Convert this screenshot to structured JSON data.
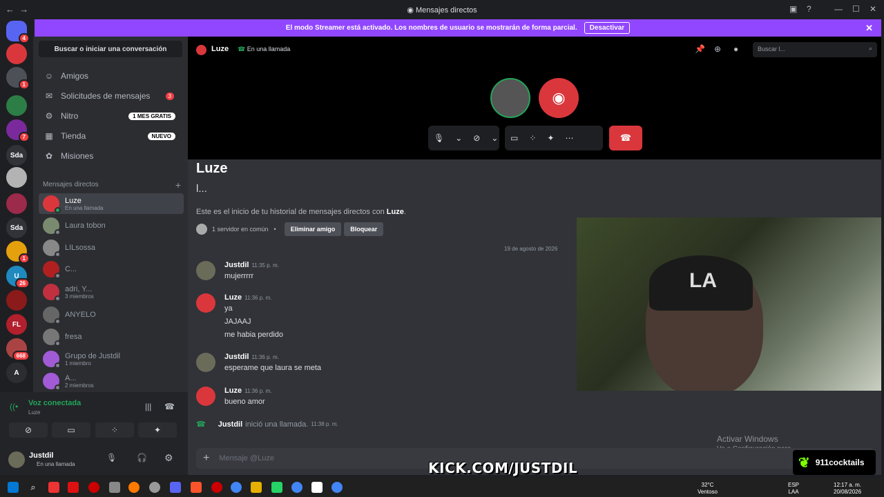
{
  "window": {
    "title": "Mensajes directos",
    "nav_back": "←",
    "nav_fwd": "→"
  },
  "banner": {
    "text": "El modo Streamer está activado. Los nombres de usuario se mostrarán de forma parcial.",
    "button": "Desactivar",
    "color": "#9147ff"
  },
  "servers": [
    {
      "label": "",
      "badge": "4",
      "color": "#5865f2"
    },
    {
      "label": "",
      "badge": "",
      "color": "#da373c"
    },
    {
      "label": "",
      "badge": "1",
      "color": "#4e5058"
    },
    {
      "label": "",
      "badge": "",
      "color": "#2d7d46"
    },
    {
      "label": "",
      "badge": "7",
      "color": "#7a2a9c"
    },
    {
      "label": "Sda",
      "badge": "",
      "color": "#313338"
    },
    {
      "label": "",
      "badge": "",
      "color": "#b3b3b3"
    },
    {
      "label": "",
      "badge": "",
      "color": "#9c2a4a"
    },
    {
      "label": "Sda",
      "badge": "",
      "color": "#313338"
    },
    {
      "label": "",
      "badge": "1",
      "color": "#e5a00d"
    },
    {
      "label": "U",
      "badge": "26",
      "color": "#1f8ac0"
    },
    {
      "label": "",
      "badge": "",
      "color": "#8b1a1a"
    },
    {
      "label": "FL",
      "badge": "",
      "color": "#b21f2d"
    },
    {
      "label": "",
      "badge": "668",
      "color": "#a44"
    },
    {
      "label": "A",
      "badge": "",
      "color": "#2b2d31"
    }
  ],
  "sidebar": {
    "search": "Buscar o iniciar una conversación",
    "nav": [
      {
        "icon": "☺",
        "label": "Amigos",
        "tag": "",
        "count": ""
      },
      {
        "icon": "✉",
        "label": "Solicitudes de mensajes",
        "tag": "",
        "count": "3"
      },
      {
        "icon": "⚙",
        "label": "Nitro",
        "tag": "1 MES GRATIS",
        "count": ""
      },
      {
        "icon": "▦",
        "label": "Tienda",
        "tag": "NUEVO",
        "count": ""
      },
      {
        "icon": "✿",
        "label": "Misiones",
        "tag": "",
        "count": ""
      }
    ],
    "dm_header": "Mensajes directos",
    "dms": [
      {
        "name": "Luze",
        "sub": "En una llamada",
        "color": "#da373c",
        "active": true
      },
      {
        "name": "Laura tobon",
        "sub": "",
        "color": "#7a8a6e",
        "active": false
      },
      {
        "name": "LILsossa",
        "sub": "",
        "color": "#888",
        "active": false
      },
      {
        "name": "C...",
        "sub": "",
        "color": "#b02020",
        "active": false
      },
      {
        "name": "adri, Y...",
        "sub": "3 miembros",
        "color": "#c03040",
        "active": false
      },
      {
        "name": "ANYELO",
        "sub": "",
        "color": "#666",
        "active": false
      },
      {
        "name": "fresa",
        "sub": "",
        "color": "#777",
        "active": false
      },
      {
        "name": "Grupo de Justdil",
        "sub": "1 miembro",
        "color": "#a25bd6",
        "active": false
      },
      {
        "name": "A...",
        "sub": "2 miembros",
        "color": "#a25bd6",
        "active": false
      }
    ]
  },
  "voice": {
    "status": "Voz conectada",
    "channel": "Luze"
  },
  "user": {
    "name": "Justdil",
    "status": "En una llamada"
  },
  "header": {
    "name": "Luze",
    "status": "En una llamada",
    "search_placeholder": "Buscar l..."
  },
  "profile": {
    "name": "Luze",
    "username": "l...",
    "intro_prefix": "Este es el inicio de tu historial de mensajes directos con ",
    "intro_name": "Luze",
    "intro_suffix": ".",
    "mutual": "1 servidor en común",
    "remove_friend": "Eliminar amigo",
    "block": "Bloquear"
  },
  "date_separator": "19 de agosto de 2026",
  "messages": [
    {
      "author": "Justdil",
      "time": "11:35 p. m.",
      "lines": [
        "mujerrrrr"
      ],
      "color": "#6b6b5a"
    },
    {
      "author": "Luze",
      "time": "11:36 p. m.",
      "lines": [
        "ya",
        "JAJAAJ",
        "me habia perdido"
      ],
      "color": "#da373c"
    },
    {
      "author": "Justdil",
      "time": "11:36 p. m.",
      "lines": [
        "esperame que laura se meta"
      ],
      "color": "#6b6b5a"
    },
    {
      "author": "Luze",
      "time": "11:36 p. m.",
      "lines": [
        "bueno amor"
      ],
      "color": "#da373c"
    }
  ],
  "call_log": {
    "author": "Justdil",
    "text": "inició una llamada.",
    "time": "11:38 p. m."
  },
  "composer": {
    "placeholder": "Mensaje @Luze"
  },
  "watermark": {
    "line1": "Activar Windows",
    "line2": "Ve a Configuración para"
  },
  "overlay": {
    "kick": "KICK.COM/JUSTDIL",
    "sponsor": "911cocktails"
  },
  "taskbar": {
    "weather_temp": "32°C",
    "weather_desc": "Ventoso",
    "lang1": "ESP",
    "lang2": "LAA",
    "time": "12:17 a. m.",
    "date": "20/08/2026"
  }
}
